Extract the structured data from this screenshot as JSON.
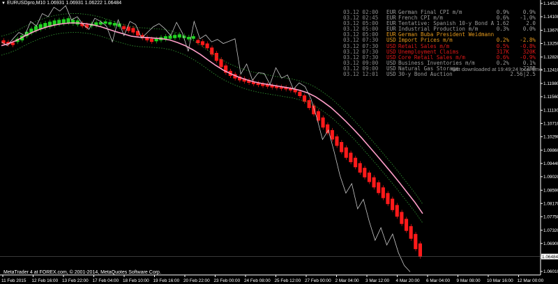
{
  "header": {
    "symbol_line": "EURUSDpro,M10  1.06931 1.06931 1.06222 1.06484"
  },
  "copyright": "MetaTrader 4 at FOREX.com, © 2001-2014, MetaQuotes Software Corp.",
  "news": {
    "downloaded": "last downloaded at 19:49:24 local time",
    "items": [
      {
        "dt": "03.12 02:00",
        "cur": "EUR",
        "event": "German Final CPI m/m",
        "fc": "0.9%",
        "pv": "0.9%",
        "color": "#9a9a9a"
      },
      {
        "dt": "03.12 02:45",
        "cur": "EUR",
        "event": "French CPI m/m",
        "fc": "0.6%",
        "pv": "-1.0%",
        "color": "#9a9a9a"
      },
      {
        "dt": "03.12 05:00",
        "cur": "EUR",
        "event": "Tentative: Spanish 10-y Bond A",
        "fc": "1.62",
        "pv": "2.0",
        "color": "#9a9a9a"
      },
      {
        "dt": "03.12 05:00",
        "cur": "EUR",
        "event": "Industrial Production m/m",
        "fc": "0.3%",
        "pv": "0.0%",
        "color": "#9a9a9a"
      },
      {
        "dt": "03.12 05:00",
        "cur": "EUR",
        "event": "German Buba President Weidmann",
        "fc": "",
        "pv": "",
        "color": "#e69a1c"
      },
      {
        "dt": "03.12 07:30",
        "cur": "USD",
        "event": "Import Prices m/m",
        "fc": "0.2%",
        "pv": "-2.8%",
        "color": "#e69a1c"
      },
      {
        "dt": "03.12 07:30",
        "cur": "USD",
        "event": "Retail Sales m/m",
        "fc": "0.5%",
        "pv": "-0.8%",
        "color": "#e01818"
      },
      {
        "dt": "03.12 07:30",
        "cur": "USD",
        "event": "Unemployment Claims",
        "fc": "317K",
        "pv": "320K",
        "color": "#e01818"
      },
      {
        "dt": "03.12 07:30",
        "cur": "USD",
        "event": "Core Retail Sales m/m",
        "fc": "0.6%",
        "pv": "-0.9%",
        "color": "#e01818"
      },
      {
        "dt": "03.12 09:00",
        "cur": "USD",
        "event": "Business Inventories m/m",
        "fc": "0.2%",
        "pv": "0.1%",
        "color": "#9a9a9a"
      },
      {
        "dt": "03.12 09:00",
        "cur": "USD",
        "event": "Natural Gas Storage",
        "fc": "",
        "pv": "-228B",
        "color": "#9a9a9a"
      },
      {
        "dt": "03.12 12:01",
        "cur": "USD",
        "event": "30-y Bond Auction",
        "fc": "",
        "pv": "2.56|2.5",
        "color": "#9a9a9a"
      }
    ]
  },
  "chart_data": {
    "type": "line",
    "symbol": "EURUSDpro",
    "timeframe": "M10",
    "ylim": [
      1.0601,
      1.1452
    ],
    "y_ticks": [
      1.1452,
      1.141,
      1.1367,
      1.1325,
      1.1282,
      1.1241,
      1.1198,
      1.1156,
      1.1113,
      1.1071,
      1.1029,
      1.0986,
      1.0944,
      1.0902,
      1.0859,
      1.0817,
      1.0775,
      1.0732,
      1.069,
      1.0647,
      1.0601
    ],
    "x_ticks": [
      "11 Feb 2015",
      "12 Feb 16:00",
      "13 Feb 22:00",
      "17 Feb 04:00",
      "18 Feb 10:00",
      "19 Feb 16:00",
      "20 Feb 22:00",
      "23 Feb 00:00",
      "24 Feb 08:00",
      "25 Feb 12:00",
      "27 Feb 00:00",
      "2 Mar 04:00",
      "3 Mar 12:00",
      "4 Mar 20:00",
      "6 Mar 04:00",
      "9 Mar 08:00",
      "10 Mar 16:00",
      "12 Mar 00:00"
    ],
    "current_price": 1.06484,
    "bar_colors": {
      "up": "#22d422",
      "down": "#ff1a1a"
    },
    "ma_color": "#ff9ec8",
    "close_line_color": "#c8c8c8",
    "envelope_color": "#2f8f2f",
    "heiken_ashi": [
      [
        1.1335,
        1.1325,
        "down"
      ],
      [
        1.133,
        1.1322,
        "down"
      ],
      [
        1.1328,
        1.132,
        "down"
      ],
      [
        1.133,
        1.134,
        "up"
      ],
      [
        1.1335,
        1.135,
        "up"
      ],
      [
        1.1348,
        1.1362,
        "up"
      ],
      [
        1.1358,
        1.1372,
        "up"
      ],
      [
        1.1365,
        1.138,
        "up"
      ],
      [
        1.137,
        1.1386,
        "up"
      ],
      [
        1.1375,
        1.139,
        "up"
      ],
      [
        1.1378,
        1.1394,
        "up"
      ],
      [
        1.1382,
        1.1398,
        "up"
      ],
      [
        1.1386,
        1.14,
        "up"
      ],
      [
        1.1388,
        1.1402,
        "up"
      ],
      [
        1.139,
        1.1405,
        "up"
      ],
      [
        1.1388,
        1.14,
        "up"
      ],
      [
        1.1385,
        1.1398,
        "up"
      ],
      [
        1.139,
        1.138,
        "down"
      ],
      [
        1.1385,
        1.1375,
        "down"
      ],
      [
        1.138,
        1.1388,
        "up"
      ],
      [
        1.1382,
        1.1392,
        "up"
      ],
      [
        1.1385,
        1.1393,
        "up"
      ],
      [
        1.1388,
        1.1395,
        "up"
      ],
      [
        1.1385,
        1.1393,
        "up"
      ],
      [
        1.1382,
        1.139,
        "up"
      ],
      [
        1.1378,
        1.1388,
        "up"
      ],
      [
        1.138,
        1.137,
        "down"
      ],
      [
        1.1378,
        1.1365,
        "down"
      ],
      [
        1.1374,
        1.136,
        "down"
      ],
      [
        1.1365,
        1.135,
        "down"
      ],
      [
        1.1352,
        1.1342,
        "down"
      ],
      [
        1.1345,
        1.1335,
        "down"
      ],
      [
        1.134,
        1.133,
        "down"
      ],
      [
        1.1332,
        1.134,
        "up"
      ],
      [
        1.1335,
        1.1345,
        "up"
      ],
      [
        1.1338,
        1.1348,
        "up"
      ],
      [
        1.134,
        1.135,
        "up"
      ],
      [
        1.1342,
        1.1352,
        "up"
      ],
      [
        1.1344,
        1.1354,
        "up"
      ],
      [
        1.1342,
        1.135,
        "up"
      ],
      [
        1.1338,
        1.1346,
        "up"
      ],
      [
        1.134,
        1.1348,
        "up"
      ],
      [
        1.1336,
        1.1326,
        "down"
      ],
      [
        1.1332,
        1.132,
        "down"
      ],
      [
        1.1325,
        1.131,
        "down"
      ],
      [
        1.1312,
        1.129,
        "down"
      ],
      [
        1.1295,
        1.127,
        "down"
      ],
      [
        1.1275,
        1.125,
        "down"
      ],
      [
        1.1255,
        1.1232,
        "down"
      ],
      [
        1.1238,
        1.1222,
        "down"
      ],
      [
        1.1228,
        1.1214,
        "down"
      ],
      [
        1.122,
        1.1208,
        "down"
      ],
      [
        1.1214,
        1.1204,
        "down"
      ],
      [
        1.1208,
        1.12,
        "down"
      ],
      [
        1.1204,
        1.1196,
        "down"
      ],
      [
        1.12,
        1.1193,
        "down"
      ],
      [
        1.1197,
        1.119,
        "down"
      ],
      [
        1.1195,
        1.1188,
        "down"
      ],
      [
        1.1192,
        1.1186,
        "down"
      ],
      [
        1.119,
        1.1184,
        "down"
      ],
      [
        1.1188,
        1.1182,
        "down"
      ],
      [
        1.1186,
        1.118,
        "down"
      ],
      [
        1.1183,
        1.1176,
        "down"
      ],
      [
        1.118,
        1.117,
        "down"
      ],
      [
        1.1172,
        1.1158,
        "down"
      ],
      [
        1.116,
        1.114,
        "down"
      ],
      [
        1.1145,
        1.112,
        "down"
      ],
      [
        1.1128,
        1.11,
        "down"
      ],
      [
        1.111,
        1.108,
        "down"
      ],
      [
        1.109,
        1.1058,
        "down"
      ],
      [
        1.1068,
        1.104,
        "down"
      ],
      [
        1.105,
        1.102,
        "down"
      ],
      [
        1.103,
        1.1,
        "down"
      ],
      [
        1.1012,
        1.098,
        "down"
      ],
      [
        1.0995,
        1.0962,
        "down"
      ],
      [
        1.0978,
        1.0948,
        "down"
      ],
      [
        1.0962,
        1.0932,
        "down"
      ],
      [
        1.0945,
        1.0915,
        "down"
      ],
      [
        1.093,
        1.09,
        "down"
      ],
      [
        1.0915,
        1.0885,
        "down"
      ],
      [
        1.09,
        1.0868,
        "down"
      ],
      [
        1.0884,
        1.085,
        "down"
      ],
      [
        1.0868,
        1.0834,
        "down"
      ],
      [
        1.085,
        1.0815,
        "down"
      ],
      [
        1.0832,
        1.0796,
        "down"
      ],
      [
        1.0812,
        1.0775,
        "down"
      ],
      [
        1.079,
        1.0752,
        "down"
      ],
      [
        1.0768,
        1.073,
        "down"
      ],
      [
        1.0745,
        1.0705,
        "down"
      ],
      [
        1.072,
        1.0672,
        "down"
      ],
      [
        1.069,
        1.0648,
        "down"
      ]
    ],
    "moving_average": [
      1.1318,
      1.1325,
      1.1335,
      1.1348,
      1.136,
      1.137,
      1.1378,
      1.1384,
      1.1388,
      1.139,
      1.139,
      1.1388,
      1.1384,
      1.1378,
      1.137,
      1.1362,
      1.1355,
      1.1348,
      1.1345,
      1.1344,
      1.1342,
      1.134,
      1.1336,
      1.1328,
      1.1318,
      1.1305,
      1.129,
      1.1272,
      1.1255,
      1.124,
      1.1228,
      1.1218,
      1.121,
      1.1203,
      1.1198,
      1.1194,
      1.119,
      1.1186,
      1.1182,
      1.1176,
      1.1168,
      1.1156,
      1.114,
      1.1122,
      1.11,
      1.1077,
      1.1052,
      1.1026,
      1.0998,
      1.097,
      1.0941,
      1.0912,
      1.0882,
      1.0851,
      1.082,
      1.0785
    ],
    "close_line": [
      1.133,
      1.1318,
      1.134,
      1.136,
      1.135,
      1.1395,
      1.138,
      1.142,
      1.141,
      1.144,
      1.1428,
      1.1445,
      1.14,
      1.141,
      1.1385,
      1.137,
      1.1405,
      1.1395,
      1.138,
      1.133,
      1.14,
      1.135,
      1.1395,
      1.1385,
      1.1342,
      1.136,
      1.1378,
      1.1388,
      1.1372,
      1.135,
      1.1392,
      1.1358,
      1.13,
      1.1395,
      1.134,
      1.1352,
      1.133,
      1.1338,
      1.1325,
      1.1332,
      1.134,
      1.1228,
      1.126,
      1.1208,
      1.1232,
      1.123,
      1.1195,
      1.1248,
      1.1215,
      1.1225,
      1.118,
      1.12,
      1.1188,
      1.115,
      1.109,
      1.102,
      1.105,
      1.098,
      1.0905,
      1.085,
      1.088,
      1.08,
      1.083,
      1.076,
      1.07,
      1.074,
      1.0685,
      1.072,
      1.066,
      1.062,
      1.06
    ]
  }
}
